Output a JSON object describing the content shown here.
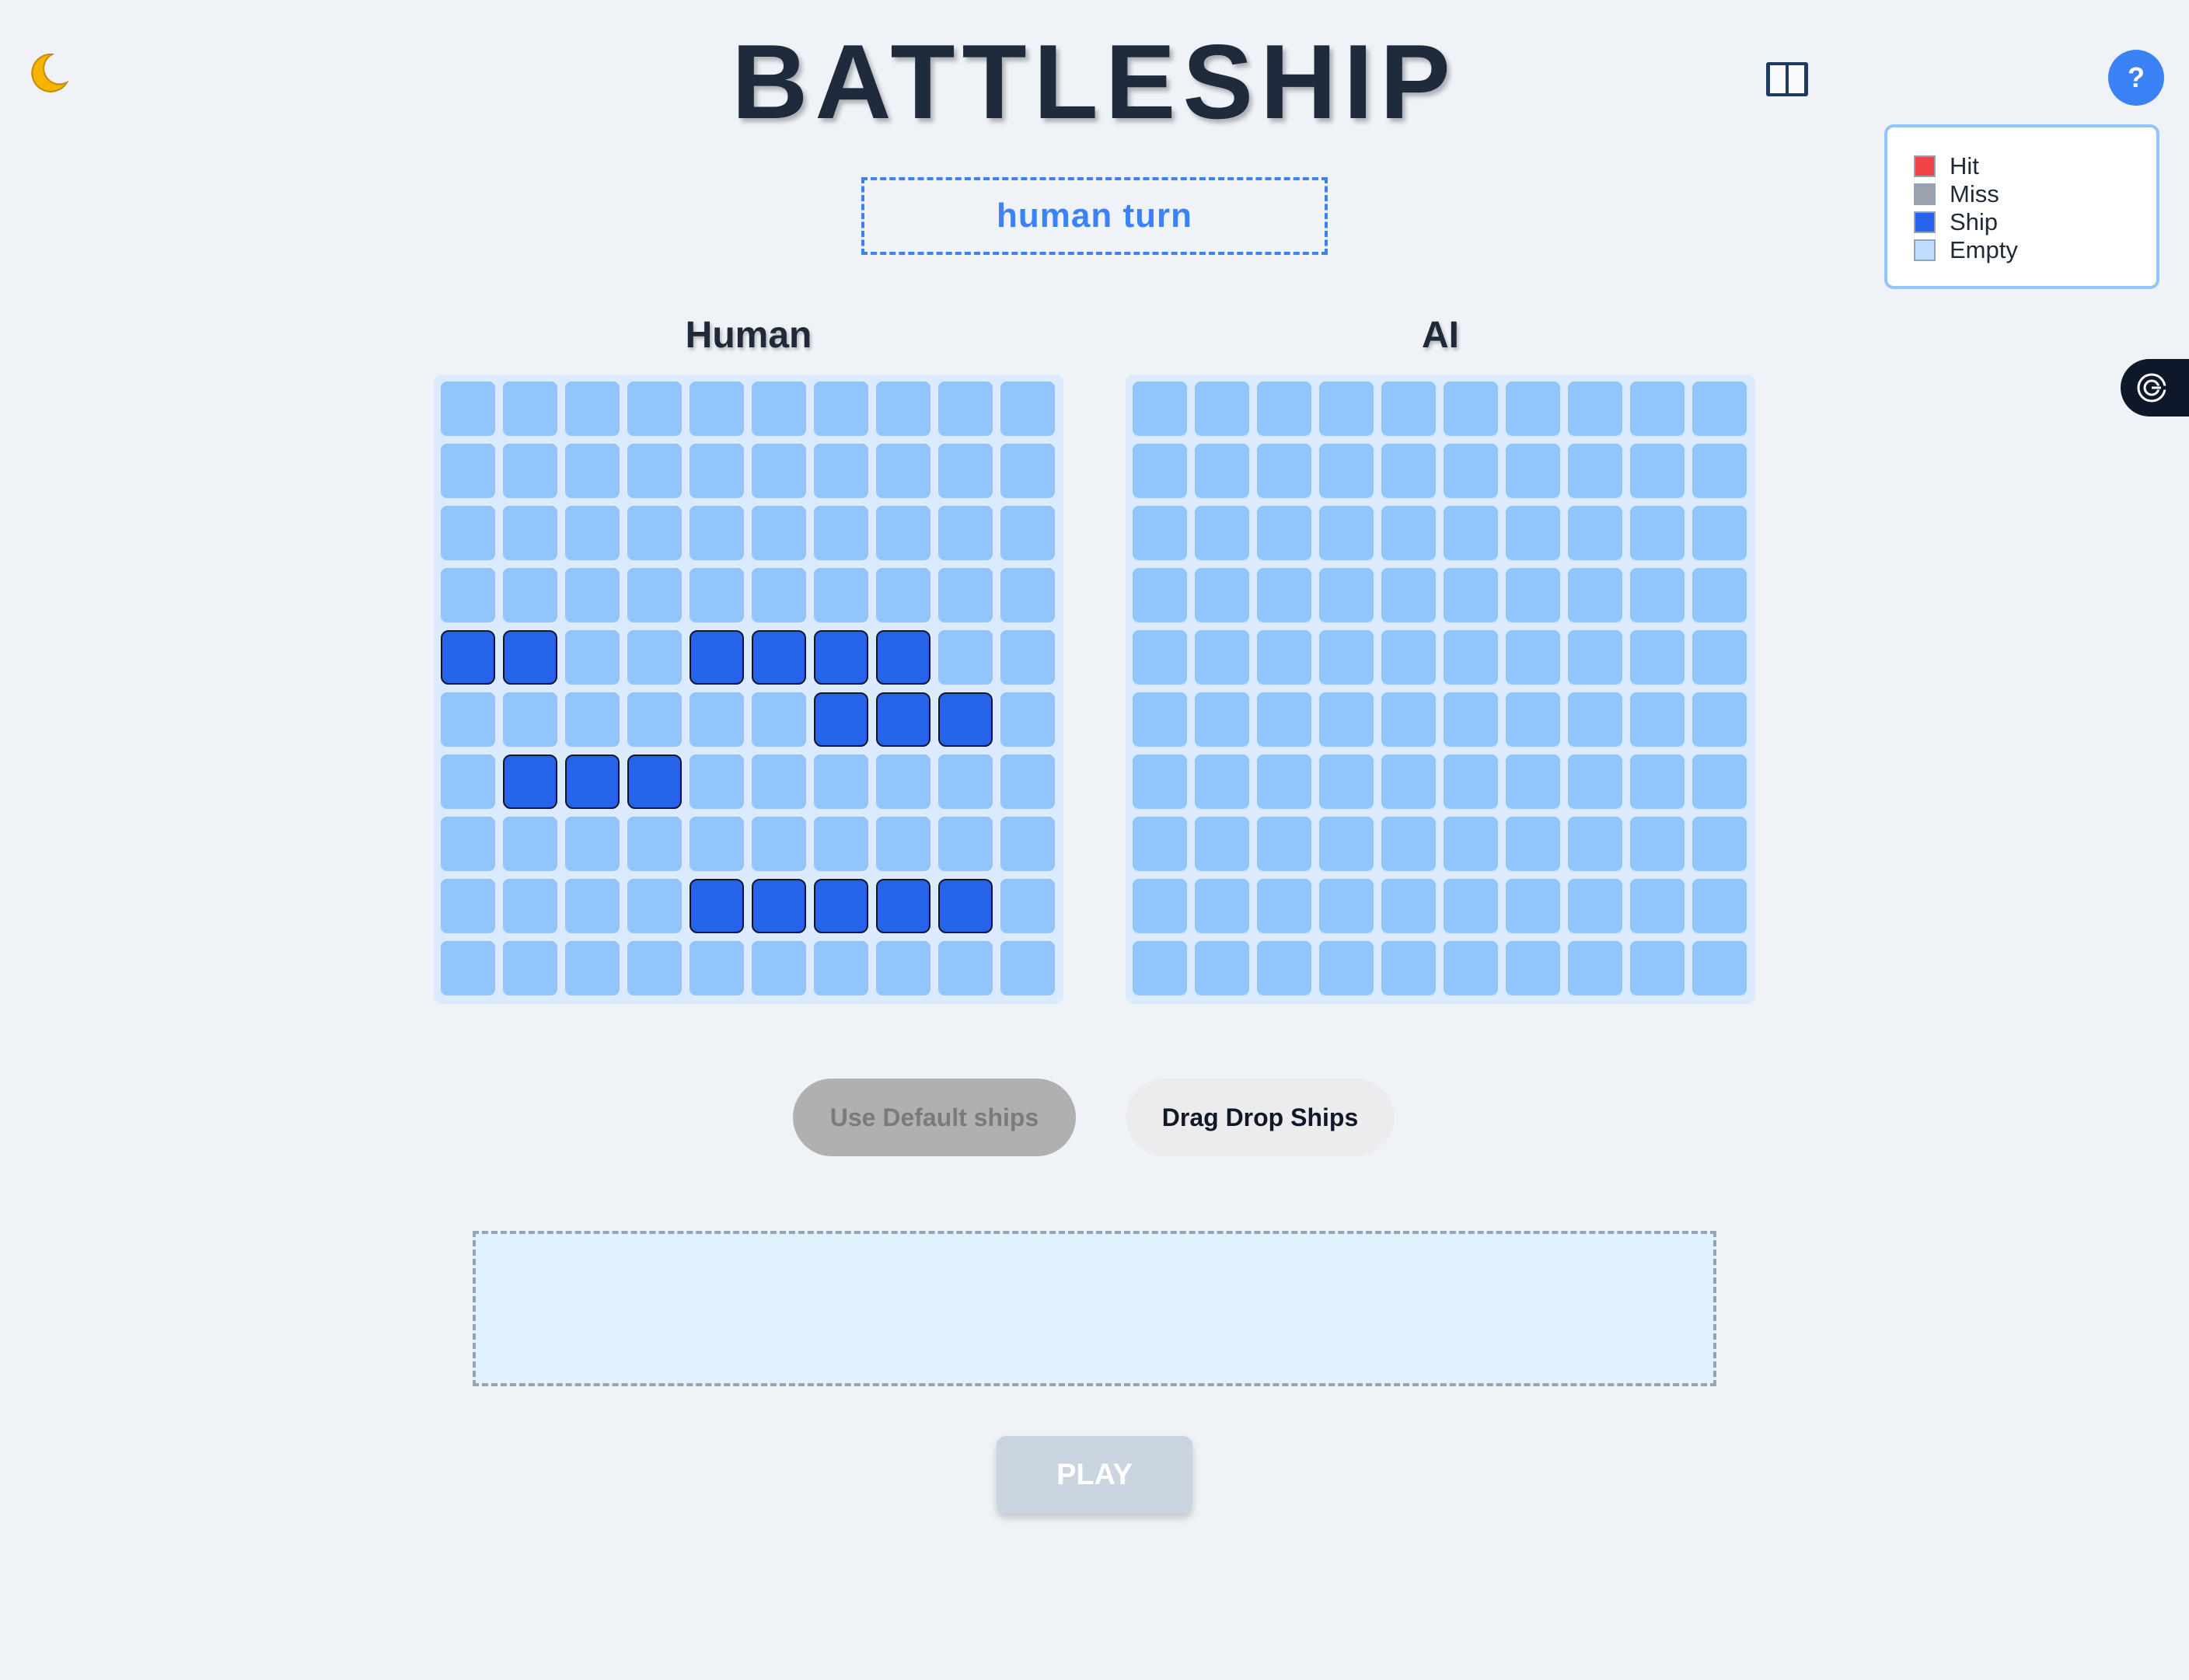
{
  "title": "BATTLESHIP",
  "turn_status": "human turn",
  "help_label": "?",
  "icons": {
    "theme_toggle": "crescent-moon-icon",
    "rules_book": "open-book-icon",
    "side_tab": "spiral-icon"
  },
  "legend": {
    "items": [
      {
        "label": "Hit",
        "color": "#ef4444"
      },
      {
        "label": "Miss",
        "color": "#9ca3af"
      },
      {
        "label": "Ship",
        "color": "#2563eb"
      },
      {
        "label": "Empty",
        "color": "#bfdbfe"
      }
    ]
  },
  "boards": [
    {
      "name": "Human",
      "rows": [
        "..........",
        "..........",
        "..........",
        "..........",
        "SS..SSSS..",
        "......SSS.",
        ".SSS......",
        "..........",
        "....SSSSS.",
        ".........."
      ]
    },
    {
      "name": "AI",
      "rows": [
        "..........",
        "..........",
        "..........",
        "..........",
        "..........",
        "..........",
        "..........",
        "..........",
        "..........",
        ".........."
      ]
    }
  ],
  "buttons": {
    "default_ships": "Use Default ships",
    "drag_drop": "Drag Drop Ships",
    "play": "PLAY"
  },
  "colors": {
    "accent": "#3b82f6",
    "ship": "#2563eb",
    "empty_cell": "#93c5fd",
    "board_bg": "#dbeafe"
  }
}
